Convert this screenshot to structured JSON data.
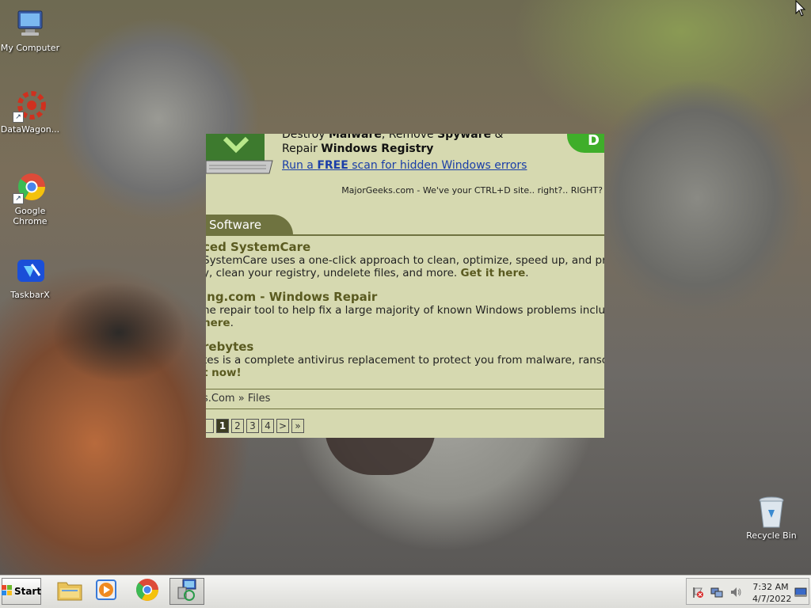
{
  "desktop": {
    "icons": [
      {
        "label": "My Computer",
        "icon": "computer-icon"
      },
      {
        "label": "DataWagon...",
        "icon": "datawagon-icon"
      },
      {
        "label": "Google Chrome",
        "icon": "chrome-icon"
      },
      {
        "label": "TaskbarX",
        "icon": "taskbarx-icon"
      },
      {
        "label": "Recycle Bin",
        "icon": "recycle-bin-icon"
      }
    ]
  },
  "web": {
    "ad": {
      "line1_prefix": "Destroy ",
      "line1_malware": "Malware",
      "line1_mid": ", Remove ",
      "line1_spyware": "Spyware",
      "line1_suffix": " &",
      "line2_prefix": "Repair ",
      "line2_bold": "Windows Registry",
      "link_prefix": "Run a ",
      "link_bold": "FREE",
      "link_suffix": " scan for hidden Windows errors",
      "button_text": "D",
      "tagline": "MajorGeeks.com - We've your CTRL+D site.. right?.. RIGHT?"
    },
    "section_tab": "Software",
    "entries": [
      {
        "title": "ced SystemCare",
        "desc_line1": "SystemCare uses a one-click approach to clean, optimize, speed up, and pr",
        "desc_line2_text": "y, clean your registry, undelete files, and more. ",
        "desc_line2_bold": "Get it here",
        "desc_line2_end": "."
      },
      {
        "title": "ing.com - Windows Repair",
        "desc_line1": "ne repair tool to help fix a large majority of known Windows problems inclu",
        "desc_line2_text": "",
        "desc_line2_bold": " here",
        "desc_line2_end": "."
      },
      {
        "title": "rebytes",
        "desc_line1": "tes is a complete antivirus replacement to protect you from malware, ranso",
        "desc_line2_text": "",
        "desc_line2_bold": "t now!",
        "desc_line2_end": ""
      }
    ],
    "breadcrumb": "s.Com » Files",
    "pager": [
      "",
      "1",
      "2",
      "3",
      "4",
      ">",
      "»"
    ],
    "pager_active_index": 1
  },
  "taskbar": {
    "start_label": "Start",
    "pinned": [
      "file-explorer-icon",
      "media-player-icon",
      "chrome-icon",
      "network-computer-icon"
    ],
    "clock_time": "7:32 AM",
    "clock_date": "4/7/2022",
    "tray_icons": [
      "action-center-flag-icon",
      "network-icon",
      "volume-icon",
      "show-desktop-icon"
    ]
  },
  "colors": {
    "page_bg": "#d6d9b0",
    "accent": "#6f7340",
    "link": "#1a3ea8",
    "ad_button": "#3fae2a"
  }
}
